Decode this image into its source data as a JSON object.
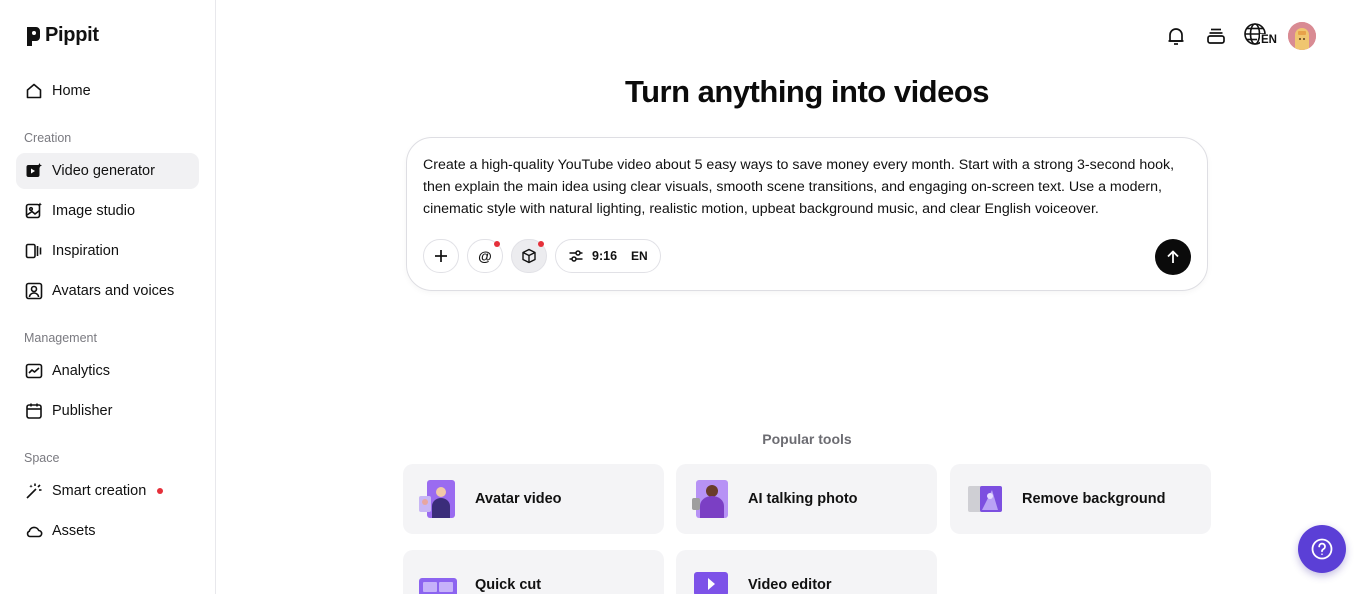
{
  "app": {
    "name": "Pippit"
  },
  "sidebar": {
    "home": "Home",
    "sections": {
      "creation": "Creation",
      "management": "Management",
      "space": "Space"
    },
    "items": [
      {
        "label": "Video generator",
        "icon": "video-generator-icon",
        "active": true
      },
      {
        "label": "Image studio",
        "icon": "image-studio-icon"
      },
      {
        "label": "Inspiration",
        "icon": "inspiration-icon"
      },
      {
        "label": "Avatars and voices",
        "icon": "avatar-icon"
      },
      {
        "label": "Analytics",
        "icon": "analytics-icon"
      },
      {
        "label": "Publisher",
        "icon": "calendar-icon"
      },
      {
        "label": "Smart creation",
        "icon": "magic-wand-icon",
        "has_notification": true
      },
      {
        "label": "Assets",
        "icon": "cloud-icon"
      }
    ]
  },
  "header": {
    "icons": [
      "bell-icon",
      "stack-icon",
      "language-globe-icon",
      "avatar"
    ],
    "language_code": "EN"
  },
  "main": {
    "headline": "Turn anything into videos",
    "prompt": {
      "value": "Create a high-quality YouTube video about 5 easy ways to save money every month. Start with a strong 3-second hook, then explain the main idea using clear visuals, smooth scene transitions, and engaging on-screen text. Use a modern, cinematic style with natural lighting, realistic motion, upbeat background music, and clear English voiceover.",
      "aspect_ratio": "9:16",
      "language": "EN"
    },
    "popular_tools_label": "Popular tools",
    "tools": [
      {
        "label": "Avatar video"
      },
      {
        "label": "AI talking photo"
      },
      {
        "label": "Remove background"
      },
      {
        "label": "Quick cut"
      },
      {
        "label": "Video editor"
      }
    ]
  },
  "colors": {
    "accent": "#5b3fd6",
    "notification": "#e5303a",
    "active_nav_bg": "#f1f1f3",
    "card_bg": "#f4f4f6"
  }
}
